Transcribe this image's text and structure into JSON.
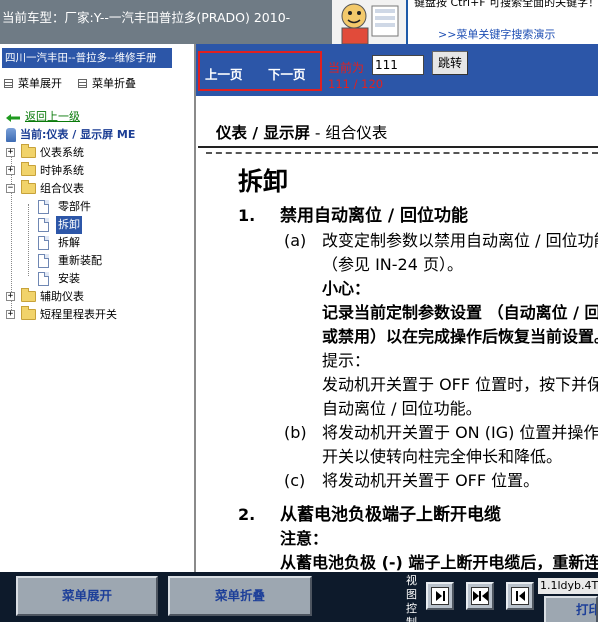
{
  "top_bar": {
    "car_model": "当前车型：厂家:Y--一汽丰田普拉多(PRADO) 2010-",
    "hint_text": "键盘按 Ctrl+F 可搜索全面的关键字！",
    "hint_link": ">>菜单关键字搜索演示"
  },
  "left_panel": {
    "manual_title": "四川一汽丰田--普拉多--维修手册",
    "expand_toggle": "菜单展开",
    "collapse_toggle": "菜单折叠",
    "back_link": "返回上一级",
    "current_node": "当前:仪表 / 显示屏 ME",
    "tree": [
      {
        "label": "仪表系统",
        "type": "folder",
        "expanded": false
      },
      {
        "label": "时钟系统",
        "type": "folder",
        "expanded": false
      },
      {
        "label": "组合仪表",
        "type": "folder",
        "expanded": true,
        "children": [
          {
            "label": "零部件",
            "selected": false
          },
          {
            "label": "拆卸",
            "selected": true
          },
          {
            "label": "拆解",
            "selected": false
          },
          {
            "label": "重新装配",
            "selected": false
          },
          {
            "label": "安装",
            "selected": false
          }
        ]
      },
      {
        "label": "辅助仪表",
        "type": "folder",
        "expanded": false
      },
      {
        "label": "短程里程表开关",
        "type": "folder",
        "expanded": false
      }
    ]
  },
  "nav": {
    "prev_page": "上一页",
    "next_page": "下一页",
    "current_page_label": "当前为",
    "page_input_value": "111",
    "jump_button": "跳转",
    "page_count": "111 / 120"
  },
  "document": {
    "section_heading_bold": "仪表 / 显示屏",
    "section_heading_rest": " - 组合仪表",
    "title": "拆卸",
    "lines": {
      "s1_num": "1.",
      "s1_title": "禁用自动离位 / 回位功能",
      "a_tag": "(a)",
      "a_line1": "改变定制参数以禁用自动离位 / 回位功能",
      "a_line2": "（参见 IN-24 页）。",
      "caution_label": "小心：",
      "caution_line1": "记录当前定制参数设置 （自动离位 / 回位功能启用",
      "caution_line2": "或禁用）以在完成操作后恢复当前设置。",
      "note_label": "提示：",
      "note_line1": "发动机开关置于 OFF 位置时，按下并保持转向柱开关可",
      "note_line2": "自动离位 / 回位功能。",
      "b_tag": "(b)",
      "b_line1": "将发动机开关置于 ON (IG) 位置并操作转向柱倾斜和伸缩",
      "b_line2": "开关以使转向柱完全伸长和降低。",
      "c_tag": "(c)",
      "c_line1": "将发动机开关置于 OFF 位置。",
      "s2_num": "2.",
      "s2_title": "从蓄电池负极端子上断开电缆",
      "notice_label": "注意：",
      "notice_line1": "从蓄电池负极 (-) 端子上断开电缆后，重新连接"
    }
  },
  "bottom_bar": {
    "menu_expand": "菜单展开",
    "menu_collapse": "菜单折叠",
    "view_control_label": "视图控制",
    "file_name": "1.1ldyb.4T",
    "print_button": "打印"
  },
  "colors": {
    "top_bar": "#6f7b85",
    "nav_blue": "#2c56a8",
    "highlight_red": "#e02020",
    "bottom_bar": "#0d1a2b",
    "button_text": "#1d3f99"
  }
}
